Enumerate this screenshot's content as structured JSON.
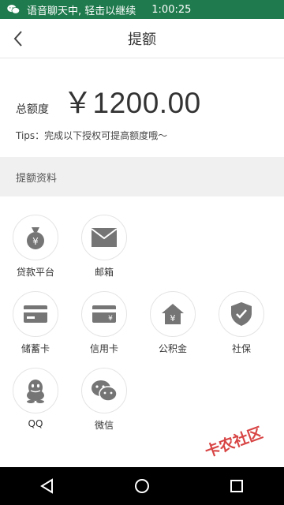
{
  "status_bar": {
    "message": "语音聊天中, 轻击以继续",
    "time": "1:00:25"
  },
  "header": {
    "title": "提额"
  },
  "amount": {
    "label": "总额度",
    "value": "￥1200.00"
  },
  "tips": "Tips：完成以下授权可提高额度哦～",
  "section": {
    "title": "提额资料"
  },
  "items": [
    {
      "label": "贷款平台",
      "icon": "money-bag-icon"
    },
    {
      "label": "邮箱",
      "icon": "envelope-icon"
    },
    {
      "label": "储蓄卡",
      "icon": "debit-card-icon"
    },
    {
      "label": "信用卡",
      "icon": "credit-card-icon"
    },
    {
      "label": "公积金",
      "icon": "house-fund-icon"
    },
    {
      "label": "社保",
      "icon": "shield-check-icon"
    },
    {
      "label": "QQ",
      "icon": "qq-icon"
    },
    {
      "label": "微信",
      "icon": "wechat-icon"
    }
  ],
  "watermark": "卡农社区",
  "colors": {
    "status_bar": "#1f7a4d",
    "icon_gray": "#757575",
    "section_bg": "#f0f0f0"
  }
}
